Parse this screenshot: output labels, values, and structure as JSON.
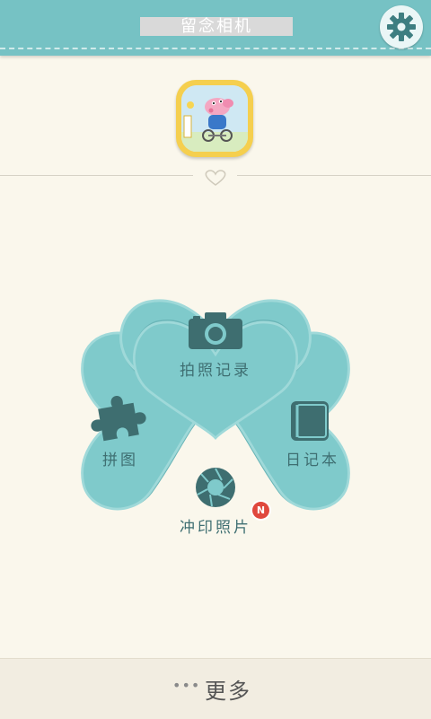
{
  "header": {
    "title": "留念相机",
    "settings_icon": "gear-icon",
    "background_color": "#76c2c4"
  },
  "avatar": {
    "icon": "peppa-pig-avatar"
  },
  "menu": {
    "take_photo": {
      "label": "拍照记录",
      "icon": "camera-icon"
    },
    "puzzle": {
      "label": "拼图",
      "icon": "puzzle-icon"
    },
    "diary": {
      "label": "日记本",
      "icon": "notebook-icon"
    },
    "print": {
      "label": "冲印照片",
      "icon": "shutter-icon",
      "badge": "N"
    }
  },
  "footer": {
    "dots": "•••",
    "more_label": "更多"
  },
  "colors": {
    "leaf": "#7fcacb",
    "leaf_edge": "#6ab5b7",
    "icon": "#3e6e70",
    "badge": "#e0483e"
  }
}
